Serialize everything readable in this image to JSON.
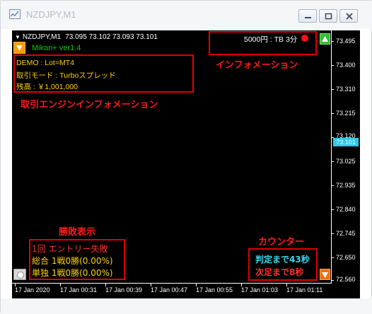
{
  "window": {
    "title": "NZDJPY,M1"
  },
  "chart": {
    "symbol_header": "NZDJPY,M1",
    "ohlc": "73.095 73.102 73.093 73.101",
    "current_price": "73.101",
    "ea_name": "Mikan+ ver1.4",
    "price_axis": [
      "73.495",
      "73.400",
      "73.310",
      "73.215",
      "73.120",
      "73.025",
      "72.935",
      "72.840",
      "72.745",
      "72.650",
      "72.560"
    ],
    "time_axis": [
      "17 Jan 2020",
      "17 Jan 00:31",
      "17 Jan 00:39",
      "17 Jan 00:47",
      "17 Jan 00:55",
      "17 Jan 01:03",
      "17 Jan 01:11"
    ]
  },
  "info_panel": {
    "text": "5000円 : TB 3分",
    "annotation": "インフォメーション",
    "status_color": "#ff1010"
  },
  "engine_panel": {
    "lines": [
      "DEMO : Lot=MT4",
      "取引モード : Turboスプレッド",
      "残高 : ￥1,001,000"
    ],
    "annotation": "取引エンジンインフォメーション"
  },
  "results_panel": {
    "annotation": "勝敗表示",
    "line1": "1回 エントリー失敗",
    "line2": "総合 1戦0勝(0.00%)",
    "line3": "単独 1戦0勝(0.00%)"
  },
  "counter_panel": {
    "annotation": "カウンター",
    "line1": "判定まで43秒",
    "line2": "次足まで8秒"
  },
  "colors": {
    "annotation_red": "#e00000",
    "ea_green": "#00d000",
    "engine_yellow": "#ffd200",
    "current_price_bg": "#2ec8ee"
  }
}
